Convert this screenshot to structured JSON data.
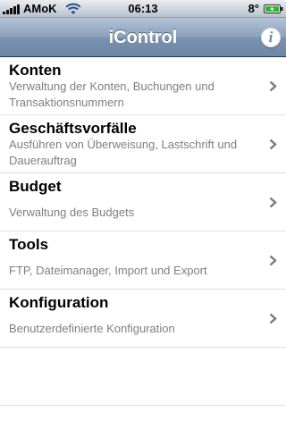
{
  "status_bar": {
    "carrier": "AMoK",
    "time": "06:13",
    "temperature": "8°",
    "signal_icon": "signal-bars-icon",
    "wifi_icon": "wifi-icon",
    "battery_icon": "battery-charging-icon"
  },
  "nav_bar": {
    "title": "iControl",
    "info_icon": "info-icon",
    "info_glyph": "i"
  },
  "menu": {
    "items": [
      {
        "title": "Konten",
        "subtitle": "Verwaltung der Konten, Buchungen und Transaktionsnummern"
      },
      {
        "title": "Geschäftsvorfälle",
        "subtitle": "Ausführen von Überweisung, Lastschrift und Dauerauftrag"
      },
      {
        "title": "Budget",
        "subtitle": "Verwaltung des Budgets"
      },
      {
        "title": "Tools",
        "subtitle": "FTP, Dateimanager, Import und Export"
      },
      {
        "title": "Konfiguration",
        "subtitle": "Benutzerdefinierte Konfiguration"
      }
    ],
    "chevron_icon": "chevron-right-icon"
  },
  "colors": {
    "nav_gradient_top": "#b4c3d6",
    "nav_gradient_bottom": "#6d87a8",
    "subtitle_gray": "#7f7f7f",
    "separator": "#e0e0e0"
  }
}
